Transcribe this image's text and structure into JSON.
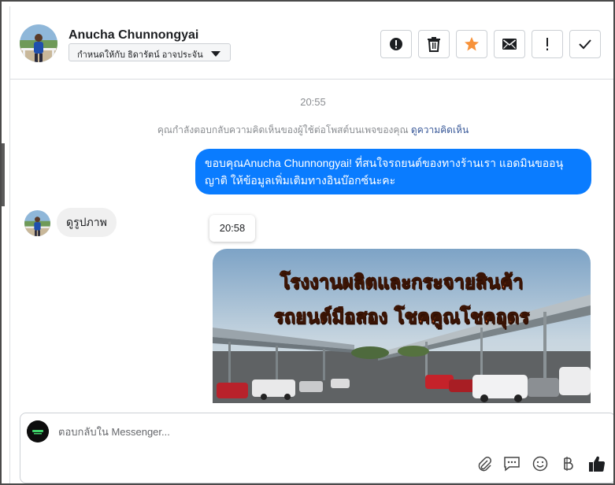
{
  "header": {
    "contact_name": "Anucha Chunnongyai",
    "assign_label": "กำหนดให้กับ ธิดารัตน์ อาจประจัน",
    "toolbar": [
      {
        "name": "spam-button",
        "icon": "exclamation-circle-icon"
      },
      {
        "name": "delete-button",
        "icon": "trash-icon"
      },
      {
        "name": "star-button",
        "icon": "star-icon",
        "active_color": "#f7923a"
      },
      {
        "name": "mark-unread-button",
        "icon": "envelope-icon"
      },
      {
        "name": "follow-up-button",
        "icon": "exclamation-icon"
      },
      {
        "name": "mark-done-button",
        "icon": "check-icon"
      }
    ]
  },
  "conversation": {
    "time_separator": "20:55",
    "context_text": "คุณกำลังตอบกลับความคิดเห็นของผู้ใช้ต่อโพสต์บนเพจของคุณ",
    "context_link": "ดูความคิดเห็น",
    "outgoing_message": "ขอบคุณAnucha Chunnongyai! ที่สนใจรถยนต์ของทางร้านเรา แอดมินขออนุญาติ ให้ข้อมูลเพิ่มเติมทางอินบ๊อกซ์นะคะ",
    "incoming_message": "ดูรูปภาพ",
    "timestamp_tooltip": "20:58",
    "image": {
      "line1": "โรงงานผลิตและกระจายสินค้า",
      "line2": "รถยนต์มือสอง โชคคูณโชคอุดร"
    }
  },
  "composer": {
    "placeholder": "ตอบกลับใน Messenger...",
    "value": ""
  },
  "colors": {
    "brand_blue": "#0a7cff",
    "star_orange": "#f7923a",
    "link": "#385898"
  }
}
